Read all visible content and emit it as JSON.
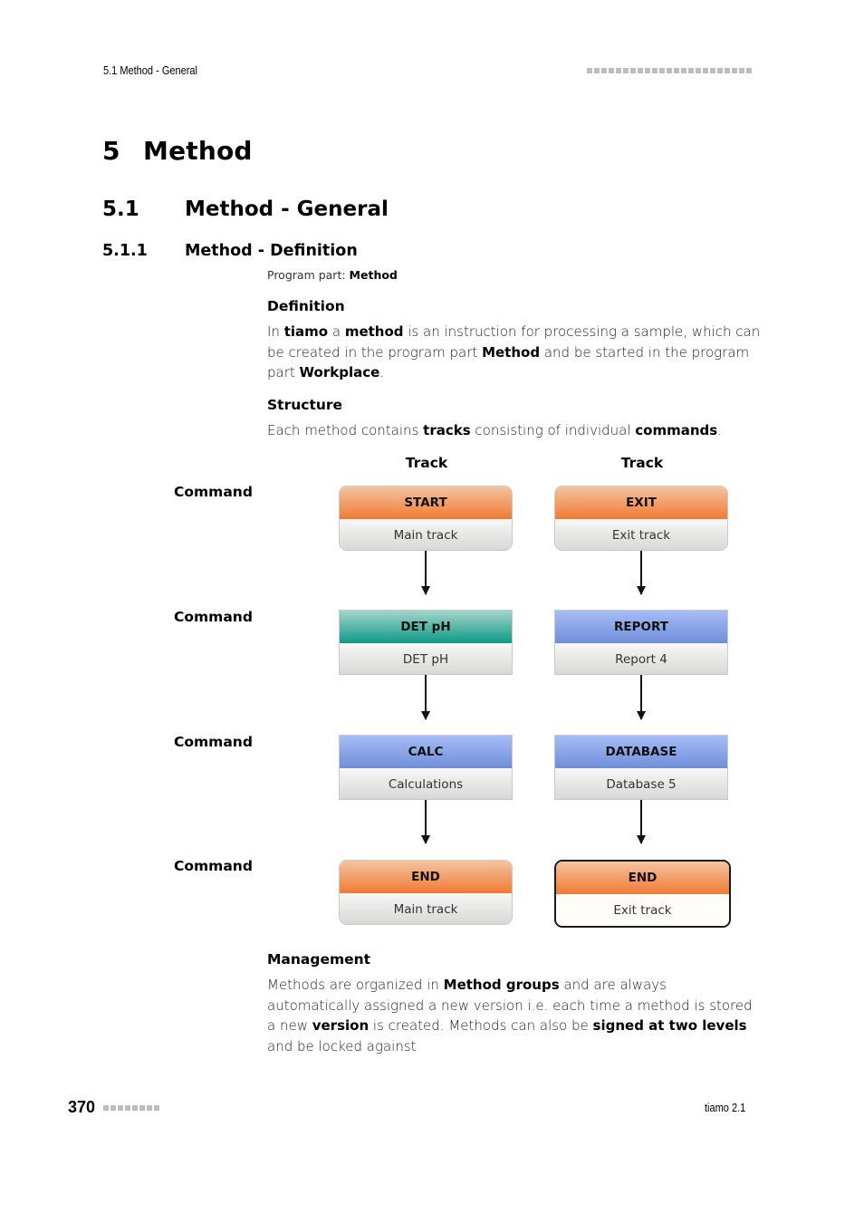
{
  "header": {
    "running_title": "5.1 Method - General",
    "dots_count": 23
  },
  "headings": {
    "h1": {
      "num": "5",
      "title": "Method"
    },
    "h2": {
      "num": "5.1",
      "title": "Method - General"
    },
    "h3": {
      "num": "5.1.1",
      "title": "Method - Definition"
    }
  },
  "program_part": {
    "label": "Program part:",
    "value": "Method"
  },
  "definition": {
    "title": "Definition",
    "p1": "In ",
    "b1": "tiamo",
    "p2": " a ",
    "b2": "method",
    "p3": " is an instruction for processing a sample, which can be created in the program part ",
    "b3": "Method",
    "p4": " and be started in the program part ",
    "b4": "Workplace",
    "p5": "."
  },
  "structure": {
    "title": "Structure",
    "p1": "Each method contains ",
    "b1": "tracks",
    "p2": " consisting of individual ",
    "b2": "commands",
    "p3": "."
  },
  "diagram": {
    "track_labels": [
      "Track",
      "Track"
    ],
    "command_labels": [
      "Command",
      "Command",
      "Command",
      "Command"
    ],
    "tracks": [
      {
        "commands": [
          {
            "type": "START",
            "name": "Main track",
            "color": "orange"
          },
          {
            "type": "DET pH",
            "name": "DET pH",
            "color": "teal"
          },
          {
            "type": "CALC",
            "name": "Calculations",
            "color": "blue"
          },
          {
            "type": "END",
            "name": "Main track",
            "color": "orange"
          }
        ]
      },
      {
        "commands": [
          {
            "type": "EXIT",
            "name": "Exit track",
            "color": "orange"
          },
          {
            "type": "REPORT",
            "name": "Report 4",
            "color": "blue"
          },
          {
            "type": "DATABASE",
            "name": "Database 5",
            "color": "blue"
          },
          {
            "type": "END",
            "name": "Exit track",
            "color": "orange",
            "selected": true
          }
        ]
      }
    ],
    "colors": {
      "orange": "#f07a33",
      "teal": "#0e9a85",
      "blue": "#6f8dd8"
    }
  },
  "management": {
    "title": "Management",
    "p1": "Methods are organized in ",
    "b1": "Method groups",
    "p2": " and are always automatically assigned a new version i.e. each time a method is stored a new ",
    "b2": "version",
    "p3": " is created. Methods can also be ",
    "b3": "signed at two levels",
    "p4": " and be locked against"
  },
  "footer": {
    "page_number": "370",
    "dots_count": 8,
    "product": "tiamo 2.1"
  }
}
